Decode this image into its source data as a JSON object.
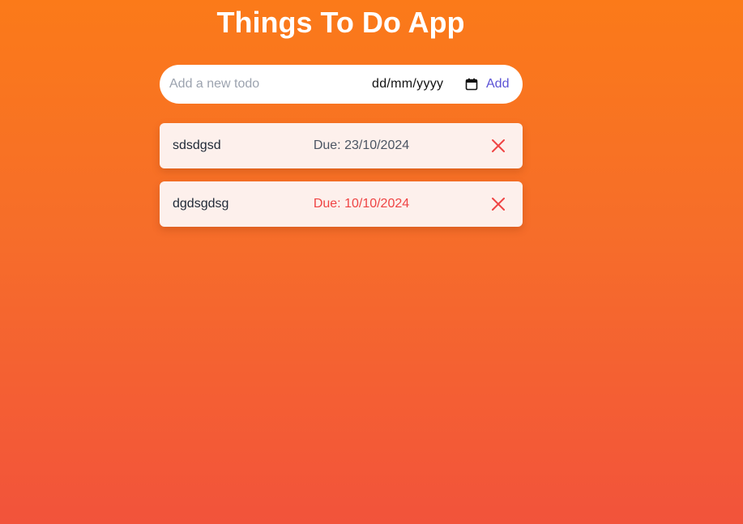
{
  "app": {
    "title": "Things To Do App"
  },
  "add_form": {
    "input_placeholder": "Add a new todo",
    "input_value": "",
    "date_value": "dd/mm/yyyy",
    "add_label": "Add"
  },
  "todos": [
    {
      "text": "sdsdgsd",
      "due": "Due: 23/10/2024",
      "overdue": false
    },
    {
      "text": "dgdsgdsg",
      "due": "Due: 10/10/2024",
      "overdue": true
    }
  ],
  "colors": {
    "background_top": "#fb7a19",
    "background_bottom": "#f2533b",
    "accent": "#5b52d6",
    "overdue": "#ef4444",
    "delete_icon": "#ef4444",
    "card": "#fdf0ec"
  },
  "icons": {
    "date": "calendar-icon",
    "delete": "close-icon"
  }
}
